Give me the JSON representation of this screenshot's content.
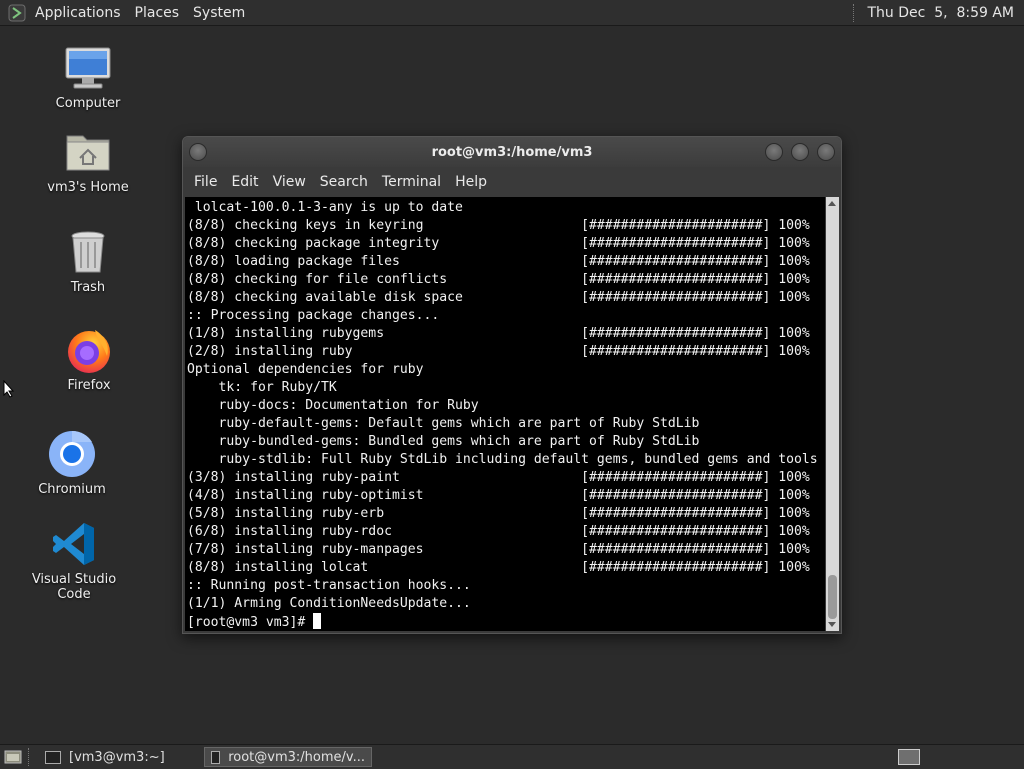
{
  "top_panel": {
    "menus": [
      "Applications",
      "Places",
      "System"
    ],
    "clock": "Thu Dec  5,  8:59 AM"
  },
  "desktop_icons": [
    {
      "label": "Computer",
      "icon": "computer-icon"
    },
    {
      "label": "vm3's Home",
      "icon": "home-folder-icon"
    },
    {
      "label": "Trash",
      "icon": "trash-icon"
    },
    {
      "label": "Firefox",
      "icon": "firefox-icon"
    },
    {
      "label": "Chromium",
      "icon": "chromium-icon"
    },
    {
      "label": "Visual Studio Code",
      "icon": "vscode-icon"
    }
  ],
  "terminal": {
    "title": "root@vm3:/home/vm3",
    "menu": [
      "File",
      "Edit",
      "View",
      "Search",
      "Terminal",
      "Help"
    ],
    "lines": [
      " lolcat-100.0.1-3-any is up to date",
      "(8/8) checking keys in keyring                    [######################] 100%",
      "(8/8) checking package integrity                  [######################] 100%",
      "(8/8) loading package files                       [######################] 100%",
      "(8/8) checking for file conflicts                 [######################] 100%",
      "(8/8) checking available disk space               [######################] 100%",
      ":: Processing package changes...",
      "(1/8) installing rubygems                         [######################] 100%",
      "(2/8) installing ruby                             [######################] 100%",
      "Optional dependencies for ruby",
      "    tk: for Ruby/TK",
      "    ruby-docs: Documentation for Ruby",
      "    ruby-default-gems: Default gems which are part of Ruby StdLib",
      "    ruby-bundled-gems: Bundled gems which are part of Ruby StdLib",
      "    ruby-stdlib: Full Ruby StdLib including default gems, bundled gems and tools",
      "(3/8) installing ruby-paint                       [######################] 100%",
      "(4/8) installing ruby-optimist                    [######################] 100%",
      "(5/8) installing ruby-erb                         [######################] 100%",
      "(6/8) installing ruby-rdoc                        [######################] 100%",
      "(7/8) installing ruby-manpages                    [######################] 100%",
      "(8/8) installing lolcat                           [######################] 100%",
      ":: Running post-transaction hooks...",
      "(1/1) Arming ConditionNeedsUpdate..."
    ],
    "prompt": "[root@vm3 vm3]# "
  },
  "taskbar": {
    "tasks": [
      {
        "label": "[vm3@vm3:~]",
        "active": false
      },
      {
        "label": "root@vm3:/home/v...",
        "active": true
      }
    ]
  },
  "colors": {
    "desktop_bg": "#2b2b2b",
    "panel_bg": "#2f2f2f",
    "terminal_bg": "#000000",
    "terminal_fg": "#f2f2f2"
  }
}
